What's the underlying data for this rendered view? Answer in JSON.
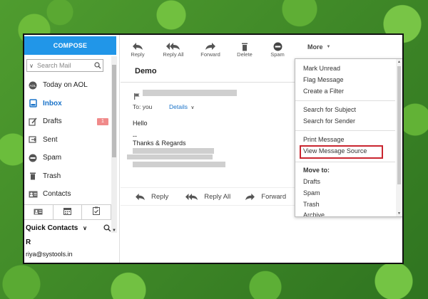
{
  "sidebar": {
    "compose_label": "COMPOSE",
    "search_placeholder": "Search Mail",
    "folders": [
      {
        "label": "Today on AOL",
        "icon": "aol-icon"
      },
      {
        "label": "Inbox",
        "icon": "inbox-icon"
      },
      {
        "label": "Drafts",
        "icon": "drafts-icon",
        "badge": "1"
      },
      {
        "label": "Sent",
        "icon": "sent-icon"
      },
      {
        "label": "Spam",
        "icon": "spam-icon"
      },
      {
        "label": "Trash",
        "icon": "trash-icon"
      },
      {
        "label": "Contacts",
        "icon": "contacts-icon"
      }
    ],
    "quick_contacts": {
      "title": "Quick Contacts",
      "contact_initial": "R",
      "contact_email": "riya@systools.in"
    }
  },
  "toolbar": {
    "reply": "Reply",
    "reply_all": "Reply All",
    "forward": "Forward",
    "delete": "Delete",
    "spam": "Spam",
    "more": "More"
  },
  "message": {
    "title": "Demo",
    "to_label": "To: you",
    "details_label": "Details",
    "greeting": "Hello",
    "dashes": "--",
    "signoff": "Thanks & Regards"
  },
  "reply_bar": {
    "reply": "Reply",
    "reply_all": "Reply All",
    "forward": "Forward"
  },
  "more_menu": {
    "mark_unread": "Mark Unread",
    "flag_message": "Flag Message",
    "create_filter": "Create a Filter",
    "search_subject": "Search for Subject",
    "search_sender": "Search for Sender",
    "print_message": "Print Message",
    "view_source": "View Message Source",
    "move_to": "Move to:",
    "move_drafts": "Drafts",
    "move_spam": "Spam",
    "move_trash": "Trash",
    "move_archive": "Archive"
  },
  "colors": {
    "accent": "#2196e8",
    "link": "#1a73c9",
    "highlight_box": "#c9252f",
    "badge": "#f08a8a"
  }
}
